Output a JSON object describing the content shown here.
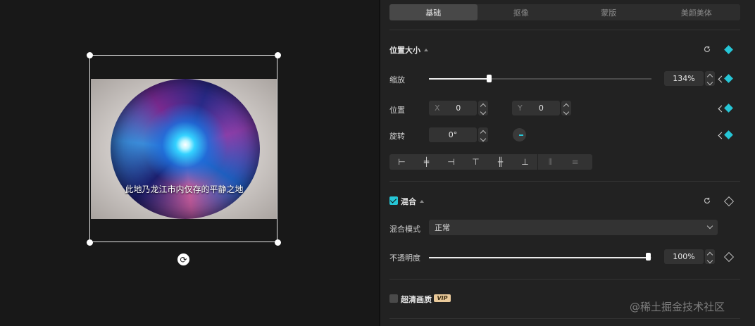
{
  "preview": {
    "subtitle": "此地乃龙江市内仅存的平静之地"
  },
  "panel": {
    "tabs": [
      {
        "label": "基础",
        "active": true
      },
      {
        "label": "抠像",
        "active": false
      },
      {
        "label": "蒙版",
        "active": false
      },
      {
        "label": "美颜美体",
        "active": false
      }
    ],
    "position_size": {
      "title": "位置大小",
      "scale_label": "缩放",
      "scale_value": "134%",
      "scale_slider_fraction": 0.34,
      "position_label": "位置",
      "x_prefix": "X",
      "x_value": "0",
      "y_prefix": "Y",
      "y_value": "0",
      "rotation_label": "旋转",
      "rotation_value": "0°"
    },
    "blend": {
      "title": "混合",
      "checked": true,
      "mode_label": "混合模式",
      "mode_value": "正常",
      "opacity_label": "不透明度",
      "opacity_value": "100%",
      "opacity_fraction": 1.0
    },
    "hd": {
      "label": "超清画质",
      "checked": false,
      "badge": "VIP"
    }
  },
  "watermark": "@稀土掘金技术社区",
  "colors": {
    "accent": "#26c6d6",
    "panel_bg": "#222222",
    "preview_bg": "#181818"
  }
}
